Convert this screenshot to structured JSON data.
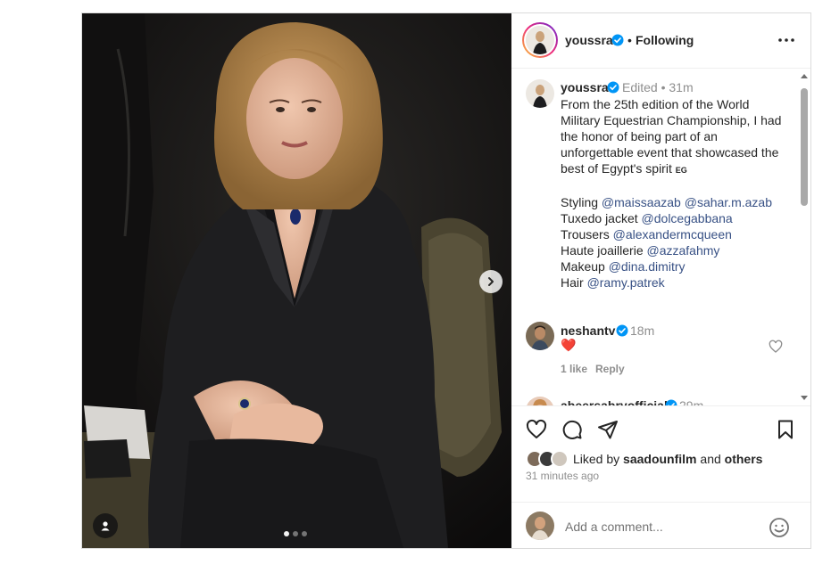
{
  "post": {
    "author": "youssra",
    "author_verified": true,
    "separator": "•",
    "follow_status": "Following",
    "more_icon": "more-horizontal-icon",
    "media": {
      "slide_count": 3,
      "active_slide": 0,
      "next_icon": "chevron-right-icon",
      "user_tag_icon": "user-tag-icon"
    }
  },
  "caption": {
    "username": "youssra",
    "edited": "Edited",
    "dot": "•",
    "time": "31m",
    "lines": [
      "From the 25th edition of the World",
      "Military Equestrian Championship, I had",
      "the honor of being part of an",
      "unforgettable event that showcased the"
    ],
    "last_line_text": "best of Egypt's spirit ",
    "flag": "EG",
    "credits": [
      {
        "label": "Styling ",
        "mentions": [
          "@maissaazab",
          "@sahar.m.azab"
        ]
      },
      {
        "label": "Tuxedo jacket ",
        "mentions": [
          "@dolcegabbana"
        ]
      },
      {
        "label": "Trousers ",
        "mentions": [
          "@alexandermcqueen"
        ]
      },
      {
        "label": "Haute joaillerie ",
        "mentions": [
          "@azzafahmy"
        ]
      },
      {
        "label": "Makeup ",
        "mentions": [
          "@dina.dimitry"
        ]
      },
      {
        "label": "Hair ",
        "mentions": [
          "@ramy.patrek"
        ]
      }
    ]
  },
  "comments": [
    {
      "username": "neshantv",
      "verified": true,
      "time": "18m",
      "text": "❤️",
      "likes": "1 like",
      "reply": "Reply"
    },
    {
      "username": "abeersabryofficial",
      "verified": true,
      "time": "29m",
      "text": "❤️❤️❤️❤️🙌"
    }
  ],
  "actions": {
    "like_icon": "heart-icon",
    "comment_icon": "comment-icon",
    "share_icon": "send-icon",
    "save_icon": "bookmark-icon",
    "liked_prefix": "Liked by ",
    "liked_user": "saadounfilm",
    "liked_and": " and ",
    "liked_others": "others",
    "time_ago": "31 minutes ago"
  },
  "comment_box": {
    "placeholder": "Add a comment...",
    "emoji_icon": "emoji-smile-icon"
  },
  "colors": {
    "link": "#385185",
    "verified": "#0095f6",
    "heart_red": "#ed4956",
    "muted": "#8e8e8e"
  }
}
